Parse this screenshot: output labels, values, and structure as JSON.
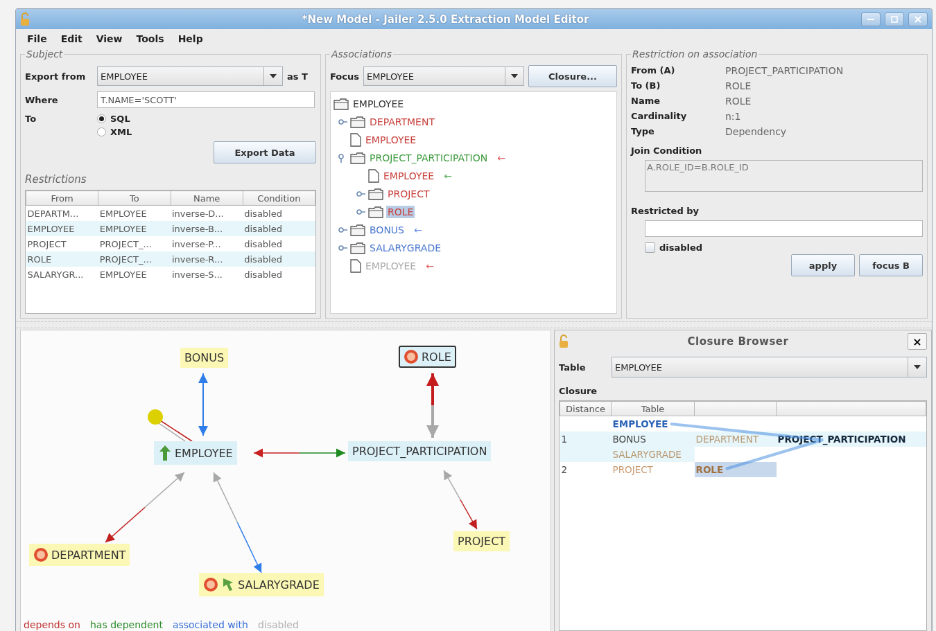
{
  "window": {
    "title": "*New Model - Jailer 2.5.0 Extraction Model Editor"
  },
  "menu": [
    "File",
    "Edit",
    "View",
    "Tools",
    "Help"
  ],
  "subject": {
    "title": "Subject",
    "export_label": "Export from",
    "export_value": "EMPLOYEE",
    "alias": "as T",
    "where_label": "Where",
    "where_value": "T.NAME='SCOTT'",
    "to_label": "To",
    "formats": [
      {
        "label": "SQL",
        "selected": true
      },
      {
        "label": "XML",
        "selected": false
      }
    ],
    "export_button": "Export Data",
    "restrictions_title": "Restrictions",
    "columns": [
      "From",
      "To",
      "Name",
      "Condition"
    ],
    "rows": [
      [
        "DEPARTM...",
        "EMPLOYEE",
        "inverse-D...",
        "disabled"
      ],
      [
        "EMPLOYEE",
        "EMPLOYEE",
        "inverse-B...",
        "disabled"
      ],
      [
        "PROJECT",
        "PROJECT_...",
        "inverse-P...",
        "disabled"
      ],
      [
        "ROLE",
        "PROJECT_...",
        "inverse-R...",
        "disabled"
      ],
      [
        "SALARYGR...",
        "EMPLOYEE",
        "inverse-S...",
        "disabled"
      ]
    ]
  },
  "associations": {
    "title": "Associations",
    "focus_label": "Focus",
    "focus_value": "EMPLOYEE",
    "closure_button": "Closure...",
    "tree": {
      "label": "EMPLOYEE",
      "kind": "folder",
      "color": "#333333",
      "selected": false,
      "children": [
        {
          "label": "DEPARTMENT",
          "kind": "folder",
          "color": "#c8403c",
          "expanded": false,
          "selected": false
        },
        {
          "label": "EMPLOYEE",
          "kind": "file",
          "color": "#c8403c",
          "selected": false
        },
        {
          "label": "PROJECT_PARTICIPATION",
          "kind": "folder",
          "color": "#3c9a3c",
          "expanded": true,
          "selected": false,
          "arrow": {
            "text": "←",
            "color": "#e06060"
          },
          "children": [
            {
              "label": "EMPLOYEE",
              "kind": "file",
              "color": "#c8403c",
              "selected": false,
              "arrow": {
                "text": "←",
                "color": "#60b060"
              }
            },
            {
              "label": "PROJECT",
              "kind": "folder",
              "color": "#c8403c",
              "expanded": false,
              "selected": false
            },
            {
              "label": "ROLE",
              "kind": "folder",
              "color": "#c8403c",
              "expanded": false,
              "selected": true
            }
          ]
        },
        {
          "label": "BONUS",
          "kind": "folder",
          "color": "#4a78d0",
          "expanded": false,
          "selected": false,
          "arrow": {
            "text": "←",
            "color": "#6a90e0"
          }
        },
        {
          "label": "SALARYGRADE",
          "kind": "folder",
          "color": "#4a78d0",
          "expanded": false,
          "selected": false
        },
        {
          "label": "EMPLOYEE",
          "kind": "file",
          "color": "#aaaaaa",
          "selected": false,
          "arrow": {
            "text": "←",
            "color": "#e06060"
          }
        }
      ]
    }
  },
  "restriction": {
    "title": "Restriction on association",
    "fields": [
      {
        "label": "From (A)",
        "value": "PROJECT_PARTICIPATION"
      },
      {
        "label": "To (B)",
        "value": "ROLE"
      },
      {
        "label": "Name",
        "value": "ROLE"
      },
      {
        "label": "Cardinality",
        "value": "n:1"
      },
      {
        "label": "Type",
        "value": "Dependency"
      }
    ],
    "join_label": "Join Condition",
    "join_value": "A.ROLE_ID=B.ROLE_ID",
    "restricted_label": "Restricted by",
    "disabled_label": "disabled",
    "disabled_checked": false,
    "buttons": [
      "apply",
      "focus B"
    ]
  },
  "graph": {
    "nodes": [
      {
        "label": "BONUS",
        "color": "#fbf7b4",
        "selected": false
      },
      {
        "label": "ROLE",
        "color": "#dcf0f7",
        "selected": true,
        "icons": [
          {
            "kind": "delete"
          }
        ]
      },
      {
        "label": "EMPLOYEE",
        "color": "#dcf0f7",
        "selected": false,
        "icons": [
          {
            "kind": "arrow-up"
          }
        ]
      },
      {
        "label": "PROJECT_PARTICIPATION",
        "color": "#dcf0f7",
        "selected": false
      },
      {
        "label": "DEPARTMENT",
        "color": "#fbf7b4",
        "selected": false,
        "icons": [
          {
            "kind": "delete"
          }
        ]
      },
      {
        "label": "SALARYGRADE",
        "color": "#fbf7b4",
        "selected": false,
        "icons": [
          {
            "kind": "delete"
          },
          {
            "kind": "all"
          }
        ]
      },
      {
        "label": "PROJECT",
        "color": "#fbf7b4",
        "selected": false
      }
    ],
    "legend": [
      {
        "label": "depends on",
        "color": "#c03030"
      },
      {
        "label": "has dependent",
        "color": "#2e8b2e"
      },
      {
        "label": "associated with",
        "color": "#3a6fd8"
      },
      {
        "label": "disabled",
        "color": "#b0b0b0"
      }
    ]
  },
  "closure_browser": {
    "title": "Closure Browser",
    "close": "×",
    "table_label": "Table",
    "table_value": "EMPLOYEE",
    "closure_label": "Closure",
    "columns": [
      "Distance",
      "Table"
    ],
    "rows": [
      [
        "",
        {
          "text": "EMPLOYEE",
          "color": "#2e64b8",
          "bold": true,
          "selected": false
        }
      ],
      [
        {
          "text": "1",
          "color": "#444444",
          "bold": false,
          "selected": false
        },
        {
          "text": "BONUS",
          "color": "#444444",
          "bold": false,
          "selected": false
        },
        {
          "text": "DEPARTMENT",
          "color": "#b89870",
          "bold": false,
          "selected": false
        },
        {
          "text": "PROJECT_PARTICIPATION",
          "color": "#14283c",
          "bold": true,
          "selected": false
        }
      ],
      [
        "",
        {
          "text": "SALARYGRADE",
          "color": "#b89870",
          "bold": false,
          "selected": false
        }
      ],
      [
        {
          "text": "2",
          "color": "#444444",
          "bold": false,
          "selected": false
        },
        {
          "text": "PROJECT",
          "color": "#c89a70",
          "bold": false,
          "selected": false
        },
        {
          "text": "ROLE",
          "color": "#a07040",
          "bold": true,
          "selected": true
        }
      ]
    ]
  }
}
